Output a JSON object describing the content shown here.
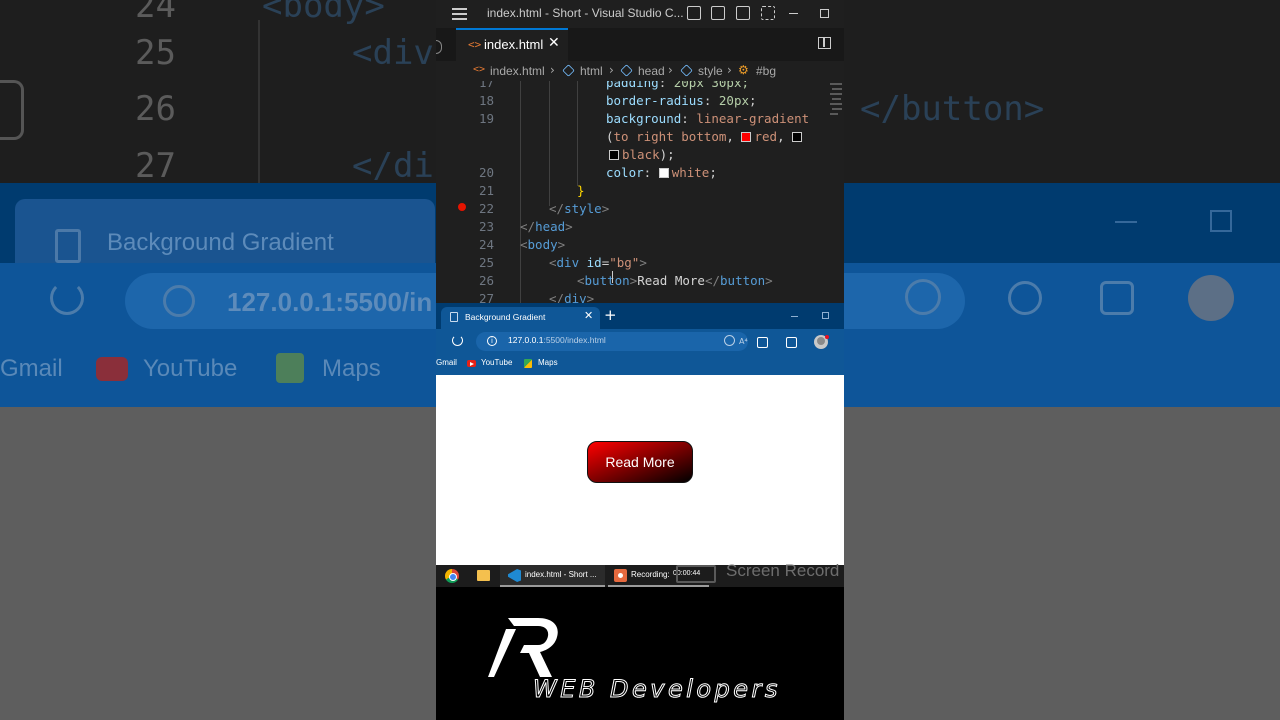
{
  "backdrop": {
    "line_numbers": [
      "24",
      "25",
      "26",
      "27"
    ],
    "code_fragments": [
      "<body>",
      "<div",
      "</button>",
      "</di"
    ],
    "tab_title": "Background Gradient",
    "url": "127.0.0.1:5500/in",
    "bookmarks": [
      "Gmail",
      "YouTube",
      "Maps"
    ]
  },
  "vscode": {
    "window_title": "index.html - Short - Visual Studio C...",
    "tab_label": "index.html",
    "tab_icon_glyph": "<>",
    "breadcrumb": {
      "file_icon_glyph": "<>",
      "file": "index.html",
      "items": [
        "html",
        "head",
        "style",
        "#bg"
      ]
    },
    "accent_color": "#0078d4",
    "line_numbers": [
      "17",
      "18",
      "19",
      "",
      "20",
      "21",
      "22",
      "23",
      "24",
      "25",
      "26",
      "27"
    ],
    "code": {
      "l17_prop": "padding",
      "l17_val": " 20px 30px;",
      "l18_prop": "border-radius",
      "l18_val": "20px",
      "l19_prop": "background",
      "l19_fn": "linear-gradient",
      "l19_args_a": "(",
      "l19_args_b": "to right bottom",
      "l19_comma": ", ",
      "l19_red": "red",
      "l19_comma2": ", ",
      "l19b_black": "black",
      "l19b_end": ");",
      "l20_prop": "color",
      "l20_val": "white",
      "l21": "}",
      "l22_tag": "style",
      "l23_tag": "head",
      "l24_tag": "body",
      "l25_tag": "div",
      "l25_attr": "id",
      "l25_val": "\"bg\"",
      "l26_tag": "button",
      "l26_text": "Read More",
      "l27_tag": "div"
    }
  },
  "edge": {
    "tab_title": "Background Gradient",
    "tab_close": "✕",
    "new_tab": "+",
    "url_host": "127.0.0.1",
    "url_rest": ":5500/index.html",
    "read_aloud": "A⁴",
    "bookmarks": [
      "Gmail",
      "YouTube",
      "Maps"
    ],
    "page": {
      "button_label": "Read More",
      "button_gradient": [
        "#ff0000",
        "#000000"
      ]
    }
  },
  "taskbar": {
    "vscode_label": "index.html - Short ...",
    "recording_label": "Recording:",
    "recording_time": "00:00:44",
    "screen_recorder_text": "Screen Record"
  },
  "branding": {
    "logo_letter": "R",
    "text": "WEB Developers"
  }
}
